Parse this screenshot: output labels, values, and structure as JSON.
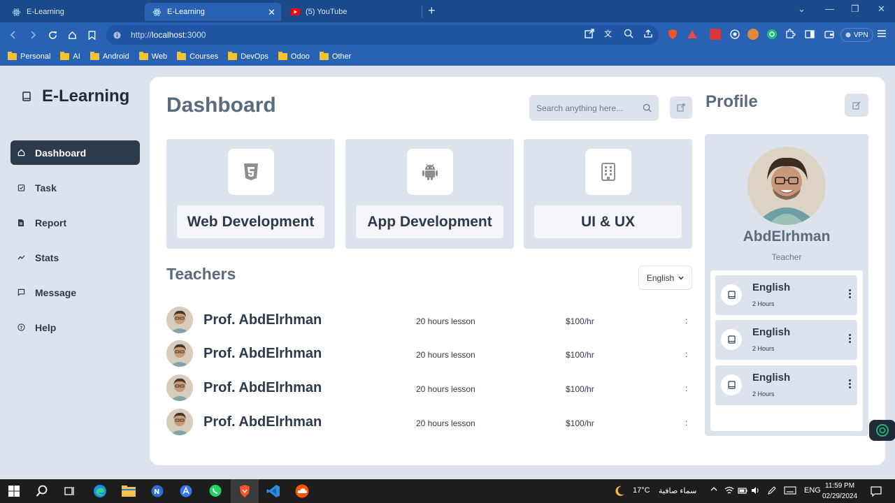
{
  "browser": {
    "tabs": [
      {
        "label": "E-Learning",
        "active": false
      },
      {
        "label": "E-Learning",
        "active": true
      },
      {
        "label": "(5) YouTube",
        "active": false
      }
    ],
    "url_prefix": "http://",
    "url_host": "localhost",
    "url_port": ":3000",
    "vpn_label": "VPN",
    "bookmarks": [
      "Personal",
      "AI",
      "Android",
      "Web",
      "Courses",
      "DevOps",
      "Odoo",
      "Other"
    ]
  },
  "app": {
    "brand": "E-Learning",
    "nav": [
      {
        "label": "Dashboard",
        "icon": "home-icon",
        "active": true
      },
      {
        "label": "Task",
        "icon": "clipboard-icon",
        "active": false
      },
      {
        "label": "Report",
        "icon": "file-icon",
        "active": false
      },
      {
        "label": "Stats",
        "icon": "chart-icon",
        "active": false
      },
      {
        "label": "Message",
        "icon": "message-icon",
        "active": false
      },
      {
        "label": "Help",
        "icon": "help-icon",
        "active": false
      }
    ],
    "dashboard": {
      "title": "Dashboard",
      "search_placeholder": "Search anything here...",
      "categories": [
        {
          "label": "Web Development",
          "icon": "html5-icon"
        },
        {
          "label": "App Development",
          "icon": "android-icon"
        },
        {
          "label": "UI & UX",
          "icon": "building-icon"
        }
      ],
      "teachers_title": "Teachers",
      "language_selected": "English",
      "teachers": [
        {
          "name": "Prof. AbdElrhman",
          "lessons": "20 hours lesson",
          "price": "$100/hr",
          "more": ":"
        },
        {
          "name": "Prof. AbdElrhman",
          "lessons": "20 hours lesson",
          "price": "$100/hr",
          "more": ":"
        },
        {
          "name": "Prof. AbdElrhman",
          "lessons": "20 hours lesson",
          "price": "$100/hr",
          "more": ":"
        },
        {
          "name": "Prof. AbdElrhman",
          "lessons": "20 hours lesson",
          "price": "$100/hr",
          "more": ":"
        }
      ]
    },
    "profile": {
      "title": "Profile",
      "name": "AbdElrhman",
      "role": "Teacher",
      "courses": [
        {
          "name": "English",
          "duration": "2 Hours"
        },
        {
          "name": "English",
          "duration": "2 Hours"
        },
        {
          "name": "English",
          "duration": "2 Hours"
        }
      ]
    }
  },
  "taskbar": {
    "weather_temp": "17°C",
    "weather_text": "سماء صافية",
    "language": "ENG",
    "time": "11:59 PM",
    "date": "02/29/2024"
  },
  "colors": {
    "browser_dark": "#1b4a8a",
    "browser_bar": "#2a62b3",
    "app_bg": "#dce3ec",
    "nav_active": "#2c3a4c",
    "heading": "#5a6b7e"
  }
}
